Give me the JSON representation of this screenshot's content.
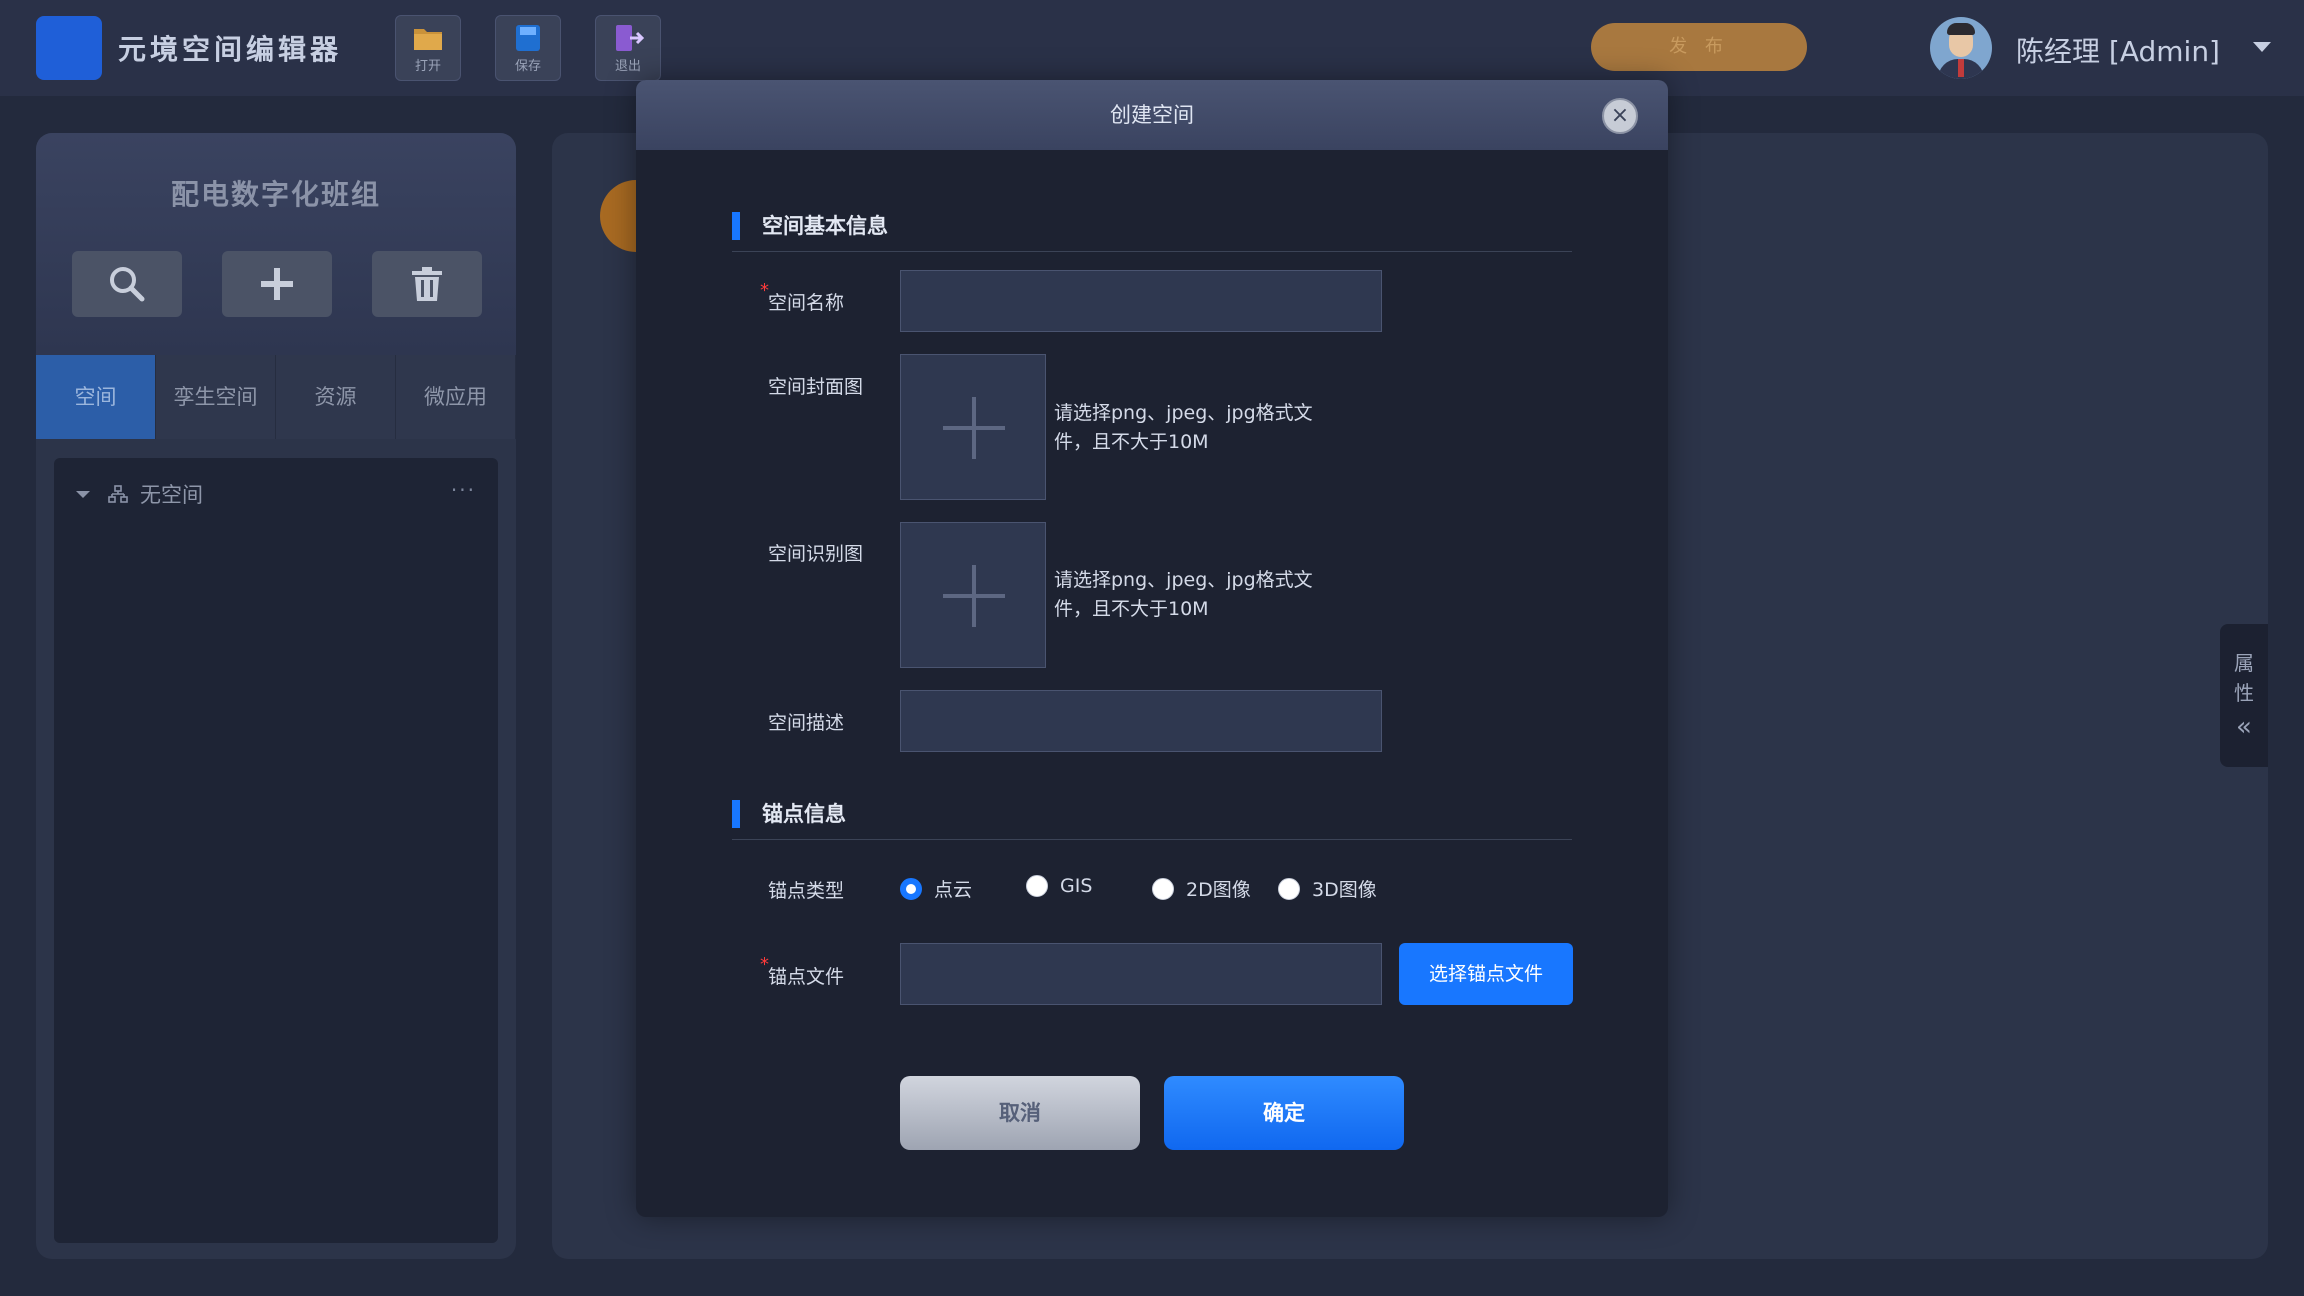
{
  "header": {
    "app_title": "元境空间编辑器",
    "tools": [
      {
        "label": "打开",
        "icon": "folder-icon",
        "color": "#c9923a"
      },
      {
        "label": "保存",
        "icon": "save-icon",
        "color": "#1f6fd1"
      },
      {
        "label": "退出",
        "icon": "exit-icon",
        "color": "#8a5bd1"
      }
    ],
    "publish_label": "发 布",
    "user_name": "陈经理  [Admin]"
  },
  "sidebar": {
    "team_name": "配电数字化班组",
    "actions": [
      {
        "icon": "search-icon"
      },
      {
        "icon": "plus-icon"
      },
      {
        "icon": "trash-icon"
      }
    ],
    "tabs": [
      {
        "label": "空间",
        "active": true
      },
      {
        "label": "孪生空间",
        "active": false
      },
      {
        "label": "资源",
        "active": false
      },
      {
        "label": "微应用",
        "active": false
      }
    ],
    "tree": {
      "item_label": "无空间",
      "more": "···"
    }
  },
  "right_panel": {
    "tab_chars": [
      "属",
      "性"
    ],
    "collapse_glyph": "«"
  },
  "modal": {
    "title": "创建空间",
    "close_glyph": "×",
    "basic_section": "空间基本信息",
    "space_name_label": "空间名称",
    "cover_label": "空间封面图",
    "cover_hint": "请选择png、jpeg、jpg格式文件，且不大于10M",
    "recog_label": "空间识别图",
    "recog_hint": "请选择png、jpeg、jpg格式文件，且不大于10M",
    "desc_label": "空间描述",
    "anchor_section": "锚点信息",
    "anchor_type_label": "锚点类型",
    "anchor_types": [
      {
        "label": "点云",
        "checked": true
      },
      {
        "label": "GIS",
        "checked": false
      },
      {
        "label": "2D图像",
        "checked": false
      },
      {
        "label": "3D图像",
        "checked": false
      }
    ],
    "anchor_file_label": "锚点文件",
    "choose_file_label": "选择锚点文件",
    "cancel_label": "取消",
    "confirm_label": "确定",
    "required_mark": "*"
  },
  "colors": {
    "accent": "#1877ff",
    "publish": "#a8783f",
    "active_tab": "#2c5ea8"
  }
}
